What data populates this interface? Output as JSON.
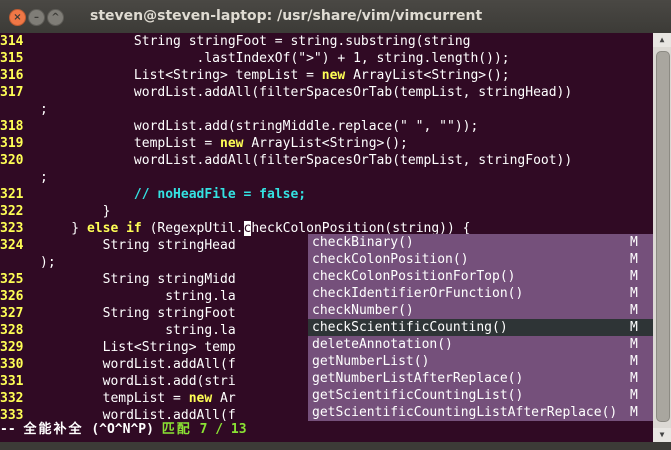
{
  "window": {
    "title": "steven@steven-laptop: /usr/share/vim/vimcurrent",
    "close_label": "×",
    "minimize_label": "–",
    "maximize_label": "^"
  },
  "editor": {
    "lines": [
      {
        "ln": "314",
        "segments": [
          {
            "t": "            String stringFoot = string.substring(string"
          }
        ]
      },
      {
        "ln": "315",
        "segments": [
          {
            "t": "                    .lastIndexOf(\">\") + 1, string.length());"
          }
        ]
      },
      {
        "ln": "316",
        "segments": [
          {
            "t": "            List<String> tempList = "
          },
          {
            "t": "new",
            "c": "kw"
          },
          {
            "t": " ArrayList<String>();"
          }
        ]
      },
      {
        "ln": "317",
        "segments": [
          {
            "t": "            wordList.addAll(filterSpacesOrTab(tempList, stringHead))"
          }
        ]
      },
      {
        "ln": "",
        "segments": [
          {
            "t": ";"
          }
        ]
      },
      {
        "ln": "318",
        "segments": [
          {
            "t": "            wordList.add(stringMiddle.replace(\" \", \"\"));"
          }
        ]
      },
      {
        "ln": "319",
        "segments": [
          {
            "t": "            tempList = "
          },
          {
            "t": "new",
            "c": "kw"
          },
          {
            "t": " ArrayList<String>();"
          }
        ]
      },
      {
        "ln": "320",
        "segments": [
          {
            "t": "            wordList.addAll(filterSpacesOrTab(tempList, stringFoot))"
          }
        ]
      },
      {
        "ln": "",
        "segments": [
          {
            "t": ";"
          }
        ]
      },
      {
        "ln": "321",
        "segments": [
          {
            "t": "            "
          },
          {
            "t": "// noHeadFile = false;",
            "c": "cm"
          }
        ]
      },
      {
        "ln": "322",
        "segments": [
          {
            "t": "        }"
          }
        ]
      },
      {
        "ln": "323",
        "segments": [
          {
            "t": "    } "
          },
          {
            "t": "else if",
            "c": "kw"
          },
          {
            "t": " (RegexpUtil."
          },
          {
            "t": "c",
            "c": "cursor"
          },
          {
            "t": "heckColonPosition(string)) {"
          }
        ]
      },
      {
        "ln": "324",
        "segments": [
          {
            "t": "        String stringHead"
          }
        ]
      },
      {
        "ln": "",
        "segments": [
          {
            "t": ");"
          }
        ]
      },
      {
        "ln": "325",
        "segments": [
          {
            "t": "        String stringMidd"
          }
        ]
      },
      {
        "ln": "326",
        "segments": [
          {
            "t": "                string.la"
          }
        ]
      },
      {
        "ln": "327",
        "segments": [
          {
            "t": "        String stringFoot"
          }
        ]
      },
      {
        "ln": "328",
        "segments": [
          {
            "t": "                string.la"
          }
        ]
      },
      {
        "ln": "329",
        "segments": [
          {
            "t": "        List<String> temp"
          }
        ]
      },
      {
        "ln": "330",
        "segments": [
          {
            "t": "        wordList.addAll(f"
          }
        ]
      },
      {
        "ln": "331",
        "segments": [
          {
            "t": "        wordList.add(stri"
          }
        ]
      },
      {
        "ln": "332",
        "segments": [
          {
            "t": "        tempList = "
          },
          {
            "t": "new",
            "c": "kw"
          },
          {
            "t": " Ar"
          }
        ]
      },
      {
        "ln": "333",
        "segments": [
          {
            "t": "        wordList.addAll(f"
          }
        ]
      }
    ]
  },
  "popup": {
    "selected_index": 5,
    "items": [
      {
        "label": "checkBinary()",
        "kind": "M"
      },
      {
        "label": "checkColonPosition()",
        "kind": "M"
      },
      {
        "label": "checkColonPositionForTop()",
        "kind": "M"
      },
      {
        "label": "checkIdentifierOrFunction()",
        "kind": "M"
      },
      {
        "label": "checkNumber()",
        "kind": "M"
      },
      {
        "label": "checkScientificCounting()",
        "kind": "M"
      },
      {
        "label": "deleteAnnotation()",
        "kind": "M"
      },
      {
        "label": "getNumberList()",
        "kind": "M"
      },
      {
        "label": "getNumberListAfterReplace()",
        "kind": "M"
      },
      {
        "label": "getScientificCountingList()",
        "kind": "M"
      },
      {
        "label": "getScientificCountingListAfterReplace()",
        "kind": "M"
      }
    ]
  },
  "status": {
    "prefix": "-- ",
    "mode": "全能补全",
    "keys": " (^O^N^P) ",
    "match_label": "匹配",
    "match_count": " 7 / 13"
  },
  "colors": {
    "background": "#300a24",
    "line_number": "#ffff55",
    "keyword": "#ffff55",
    "comment": "#34e2e2",
    "popup_bg": "#75507b",
    "popup_selected": "#2e3436",
    "match_text": "#8ae234"
  },
  "scrollbar": {
    "up_icon": "▲",
    "down_icon": "▼"
  }
}
